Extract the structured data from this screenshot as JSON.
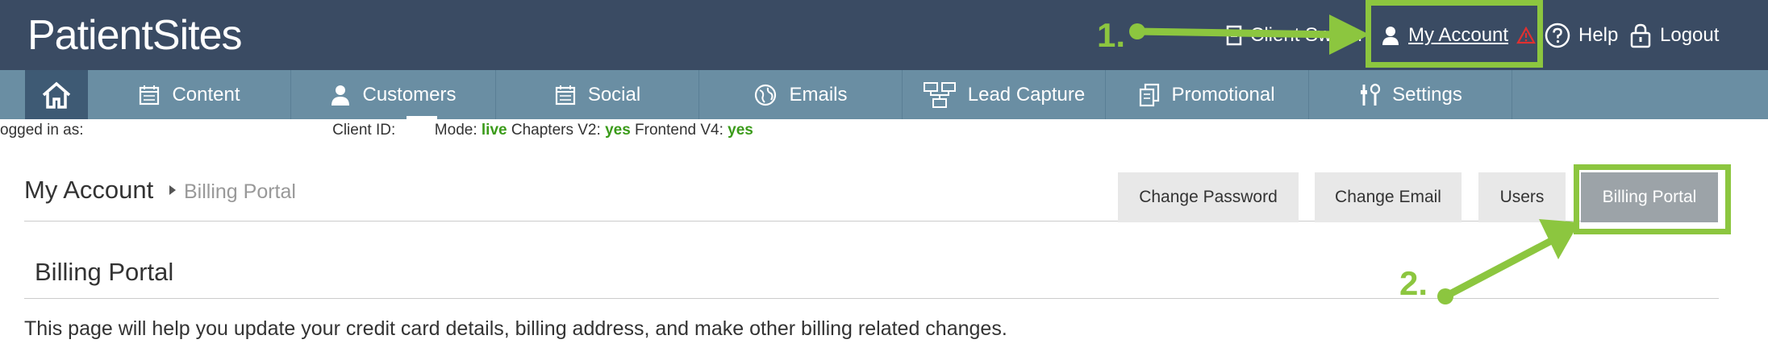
{
  "brand": {
    "name_part1": "Patient",
    "name_part2": "Sites"
  },
  "topbar": {
    "client_switch_label": "Client Switch",
    "account_label": "My Account",
    "help_label": "Help",
    "logout_label": "Logout"
  },
  "nav": {
    "items": [
      {
        "label": "Content",
        "icon": "calendar-icon"
      },
      {
        "label": "Customers",
        "icon": "person-icon"
      },
      {
        "label": "Social",
        "icon": "calendar-icon"
      },
      {
        "label": "Emails",
        "icon": "globe-icon"
      },
      {
        "label": "Lead Capture",
        "icon": "sitemap-icon"
      },
      {
        "label": "Promotional",
        "icon": "copy-icon"
      },
      {
        "label": "Settings",
        "icon": "tools-icon"
      }
    ]
  },
  "info": {
    "logged_in_label": "ogged in as:",
    "client_id_label": "Client ID:",
    "mode_label": "Mode:",
    "mode_value": "live",
    "chapters_label": "Chapters V2:",
    "chapters_value": "yes",
    "frontend_label": "Frontend V4:",
    "frontend_value": "yes"
  },
  "page": {
    "title": "My Account",
    "breadcrumb": "Billing Portal",
    "tabs": [
      "Change Password",
      "Change Email",
      "Users",
      "Billing Portal"
    ],
    "active_tab": "Billing Portal",
    "section_title": "Billing Portal",
    "description": "This page will help you update your credit card details, billing address, and make other billing related changes."
  },
  "annotations": {
    "step1": "1.",
    "step2": "2.",
    "color": "#8cc63f"
  },
  "colors": {
    "topbar": "#3a4b63",
    "navbar": "#6a8ea3",
    "nav_home": "#3e5a74",
    "status_green": "#3b9b1a",
    "warning_red": "#e03030"
  }
}
